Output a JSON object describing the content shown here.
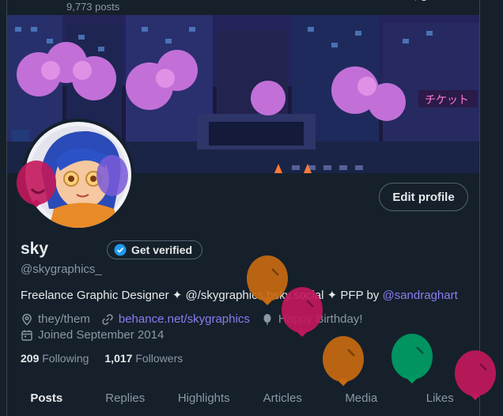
{
  "header": {
    "posts_count": "9,773 posts"
  },
  "profile": {
    "display_name": "sky",
    "handle": "@skygraphics_",
    "edit_profile_label": "Edit profile",
    "get_verified_label": "Get verified",
    "bio_text": "Freelance Graphic Designer ✦ @/skygraphics.bsky.social ✦ PFP by ",
    "bio_mention": "@sandraghart",
    "pronouns": "they/them",
    "website": "behance.net/skygraphics",
    "birthday": "Happy Birthday!",
    "joined": "Joined September 2014",
    "following_count": "209",
    "following_label": "Following",
    "followers_count": "1,017",
    "followers_label": "Followers"
  },
  "tabs": [
    {
      "label": "Posts"
    },
    {
      "label": "Replies"
    },
    {
      "label": "Highlights"
    },
    {
      "label": "Articles"
    },
    {
      "label": "Media"
    },
    {
      "label": "Likes"
    }
  ],
  "active_tab": "Posts",
  "colors": {
    "background": "#15202b",
    "accent_link": "#8c7cf0",
    "verified_blue": "#1d9bf0",
    "balloon_orange": "#c86a10",
    "balloon_pink": "#c2185b",
    "balloon_green": "#009a63"
  }
}
